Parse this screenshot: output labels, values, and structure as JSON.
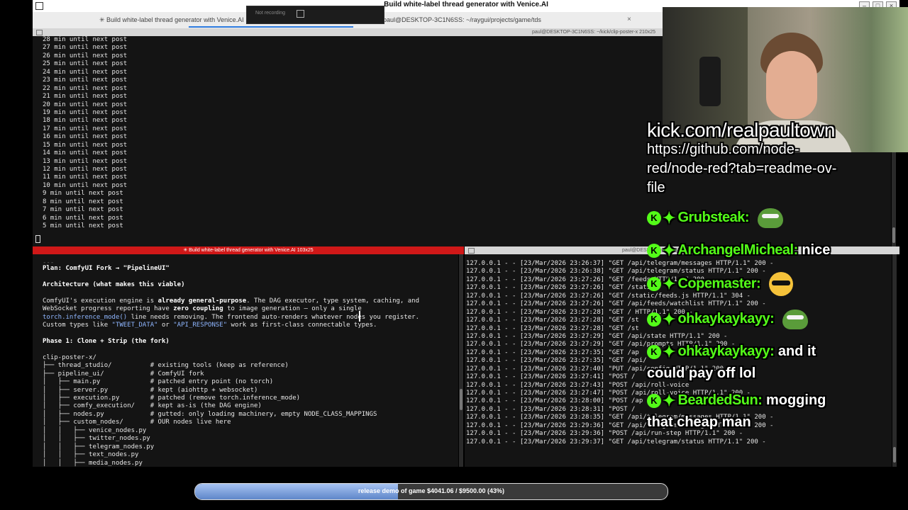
{
  "window": {
    "title": "Build white-label thread generator with Venice.AI"
  },
  "recording": {
    "status": "Not recording"
  },
  "tabs": [
    {
      "label": "✳ Build white-label thread generator with Venice.AI"
    },
    {
      "label": "paul@DESKTOP-3C1N6SS: ~/raygui/projects/game/tds"
    }
  ],
  "panes": {
    "top_title": "paul@DESKTOP-3C1N6SS: ~/kick/clip-poster-x 210x25",
    "left_title": "✳ Build white-label thread generator with Venice.AI 103x25",
    "right_title": "paul@DESKTOP-3C1N6SS:"
  },
  "top_terminal": {
    "lines": [
      "28 min until next post",
      "27 min until next post",
      "26 min until next post",
      "25 min until next post",
      "24 min until next post",
      "23 min until next post",
      "22 min until next post",
      "21 min until next post",
      "20 min until next post",
      "19 min until next post",
      "18 min until next post",
      "17 min until next post",
      "16 min until next post",
      "15 min until next post",
      "14 min until next post",
      "13 min until next post",
      "12 min until next post",
      "11 min until next post",
      "10 min until next post",
      "9 min until next post",
      "8 min until next post",
      "7 min until next post",
      "6 min until next post",
      "5 min until next post"
    ]
  },
  "left_terminal": {
    "sep": "---",
    "plan_title": "Plan: ComfyUI Fork → \"PipelineUI\"",
    "arch_title": "Architecture (what makes this viable)",
    "para1_a": "ComfyUI's execution engine is ",
    "para1_b": "already general-purpose",
    "para1_c": ". The DAG executor, type system, caching, and",
    "para2_a": "WebSocket progress reporting have ",
    "para2_b": "zero coupling",
    "para2_c": " to image generation — only a single",
    "para3_a": "torch.inference_mode()",
    "para3_b": " line needs removing. The frontend auto-renders whatever nodes you register.",
    "para4_a": "Custom types like ",
    "para4_b": "\"TWEET_DATA\"",
    "para4_c": " or ",
    "para4_d": "\"API_RESPONSE\"",
    "para4_e": " work as first-class connectable types.",
    "phase_title": "Phase 1: Clone + Strip (the fork)",
    "tree": [
      "clip-poster-x/",
      "├── thread_studio/          # existing tools (keep as reference)",
      "├── pipeline_ui/            # ComfyUI fork",
      "│   ├── main.py             # patched entry point (no torch)",
      "│   ├── server.py           # kept (aiohttp + websocket)",
      "│   ├── execution.py        # patched (remove torch.inference_mode)",
      "│   ├── comfy_execution/    # kept as-is (the DAG engine)",
      "│   ├── nodes.py            # gutted: only loading machinery, empty NODE_CLASS_MAPPINGS",
      "│   ├── custom_nodes/       # OUR nodes live here",
      "│   │   ├── venice_nodes.py",
      "│   │   ├── twitter_nodes.py",
      "│   │   ├── telegram_nodes.py",
      "│   │   ├── text_nodes.py",
      "│   │   ├── media_nodes.py"
    ]
  },
  "right_terminal": {
    "lines": [
      "127.0.0.1 - - [23/Mar/2026 23:26:37] \"GET /api/telegram/messages HTTP/1.1\" 200 -",
      "127.0.0.1 - - [23/Mar/2026 23:26:38] \"GET /api/telegram/status HTTP/1.1\" 200 -",
      "127.0.0.1 - - [23/Mar/2026 23:27:26] \"GET /feeds HTTP/1.1\" 200 -",
      "127.0.0.1 - - [23/Mar/2026 23:27:26] \"GET /static/",
      "127.0.0.1 - - [23/Mar/2026 23:27:26] \"GET /static/feeds.js HTTP/1.1\" 304 -",
      "127.0.0.1 - - [23/Mar/2026 23:27:26] \"GET /api/feeds/watchlist HTTP/1.1\" 200 -",
      "127.0.0.1 - - [23/Mar/2026 23:27:28] \"GET / HTTP/1.1\" 200 -",
      "127.0.0.1 - - [23/Mar/2026 23:27:28] \"GET /st",
      "127.0.0.1 - - [23/Mar/2026 23:27:28] \"GET /st",
      "127.0.0.1 - - [23/Mar/2026 23:27:29] \"GET /api/state HTTP/1.1\" 200 -",
      "127.0.0.1 - - [23/Mar/2026 23:27:29] \"GET /api/prompts HTTP/1.1\" 200 -",
      "127.0.0.1 - - [23/Mar/2026 23:27:35] \"GET /ap",
      "127.0.0.1 - - [23/Mar/2026 23:27:35] \"GET /api/",
      "127.0.0.1 - - [23/Mar/2026 23:27:40] \"PUT /api/config HTTP/1.1\" 200 -",
      "127.0.0.1 - - [23/Mar/2026 23:27:41] \"POST /",
      "127.0.0.1 - - [23/Mar/2026 23:27:43] \"POST /api/roll-voice",
      "127.0.0.1 - - [23/Mar/2026 23:27:47] \"POST /api/roll-voice HTTP/1.1\" 200 -",
      "127.0.0.1 - - [23/Mar/2026 23:28:00] \"POST /ap",
      "127.0.0.1 - - [23/Mar/2026 23:28:31] \"POST /",
      "127.0.0.1 - - [23/Mar/2026 23:28:35] \"GET /api/telegram/messages HTTP/1.1\" 200 -",
      "127.0.0.1 - - [23/Mar/2026 23:29:36] \"GET /api/telegram/messages HTTP/1.1\" 200 -",
      "127.0.0.1 - - [23/Mar/2026 23:29:36] \"POST /api/run-step HTTP/1.1\" 200 -",
      "127.0.0.1 - - [23/Mar/2026 23:29:37] \"GET /api/telegram/status HTTP/1.1\" 200 -"
    ]
  },
  "overlay": {
    "stream_url": "kick.com/realpaultown",
    "link_text": "https://github.com/node-red/node-red?tab=readme-ov-file",
    "chat": [
      {
        "user": "Grubsteak:",
        "message": "",
        "emote": "frog"
      },
      {
        "user": "ArchangelMicheal:",
        "message": "nice",
        "emote": ""
      },
      {
        "user": "Copemaster:",
        "message": "",
        "emote": "sunglasses"
      },
      {
        "user": "ohkaykaykayy:",
        "message": "",
        "emote": "frog"
      },
      {
        "user": "ohkaykaykayy:",
        "message": "and it could pay off lol",
        "emote": ""
      },
      {
        "user": "BeardedSun:",
        "message": "mogging that cheap man",
        "emote": ""
      }
    ]
  },
  "goal": {
    "label": "release demo of game $4041.06 / $9500.00 (43%)",
    "progress": 0.43
  },
  "colors": {
    "kick_green": "#53fc18",
    "terminal_bg": "#141414",
    "active_pane": "#d01818"
  }
}
